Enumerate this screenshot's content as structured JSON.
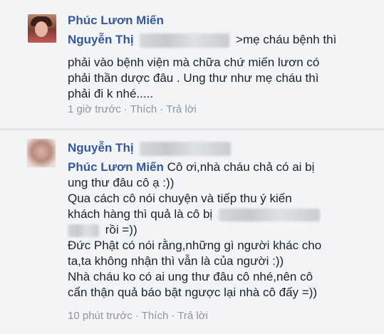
{
  "comments": [
    {
      "author": "Phúc Lươn Miến",
      "mention_first": "Nguyễn Thị",
      "line1_rest": ">mẹ cháu bệnh thì",
      "lines": [
        "phải vào bệnh viện mà chữa chứ miến lươn có",
        "phải thần dược đâu . Ung thư như mẹ cháu thì",
        "phải đi k nhé....."
      ],
      "time": "1 giờ trước",
      "like": "Thích",
      "reply": "Trả lời"
    },
    {
      "author": "Nguyễn Thị",
      "mention": "Phúc Lươn Miến",
      "line1_rest": "Cô ơi,nhà cháu chả có ai bị",
      "lines": [
        "ung thư đâu cô ạ :))",
        "Qua cách cô nói chuyện và tiếp thu ý kiến",
        "khách hàng thì quả là cô bị",
        "rồi =))",
        "Đức Phật có nói rằng,những gì người khác cho",
        "ta,ta không nhận thì vẫn là của người :))",
        "Nhà cháu ko có ai ung thư đâu cô nhé,nên cô",
        "cẩn thận quả báo bật ngược lại nhà cô đấy =))"
      ],
      "time": "10 phút trước",
      "like": "Thích",
      "reply": "Trả lời"
    }
  ],
  "separator": "·",
  "colors": {
    "name": "#365899",
    "text": "#1d2129",
    "meta": "#90949c",
    "background": "#f3f4f6"
  }
}
